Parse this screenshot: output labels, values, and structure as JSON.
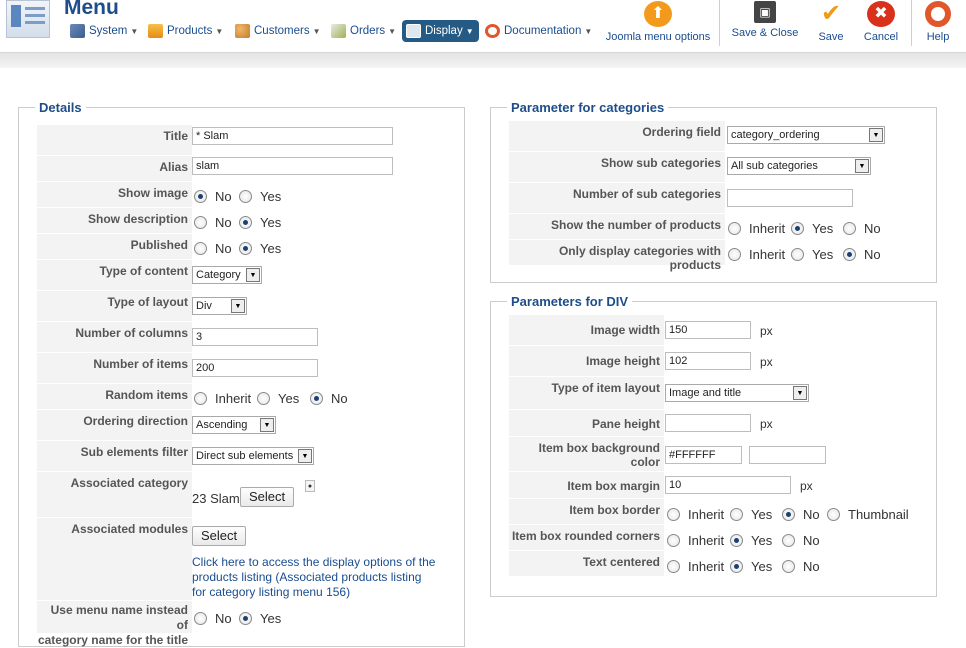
{
  "header": {
    "title": "Menu",
    "menus": [
      {
        "label": "System",
        "icon": "system-tools-icon",
        "active": false
      },
      {
        "label": "Products",
        "icon": "products-icon",
        "active": false
      },
      {
        "label": "Customers",
        "icon": "customers-icon",
        "active": false
      },
      {
        "label": "Orders",
        "icon": "orders-icon",
        "active": false
      },
      {
        "label": "Display",
        "icon": "display-icon",
        "active": true
      },
      {
        "label": "Documentation",
        "icon": "documentation-icon",
        "active": false
      }
    ],
    "toolbar": {
      "joomla_menu_options": "Joomla menu options",
      "save_close": "Save & Close",
      "save": "Save",
      "cancel": "Cancel",
      "help": "Help"
    },
    "colors": {
      "brand": "#1e4d8a",
      "active_menu": "#245a83",
      "orange": "#f39a1d",
      "cancel_red": "#d9311b"
    }
  },
  "details": {
    "legend": "Details",
    "title": {
      "label": "Title",
      "value": "* Slam"
    },
    "alias": {
      "label": "Alias",
      "value": "slam"
    },
    "show_image": {
      "label": "Show image",
      "options": [
        "No",
        "Yes"
      ],
      "selected": "No"
    },
    "show_description": {
      "label": "Show description",
      "options": [
        "No",
        "Yes"
      ],
      "selected": "Yes"
    },
    "published": {
      "label": "Published",
      "options": [
        "No",
        "Yes"
      ],
      "selected": "Yes"
    },
    "type_of_content": {
      "label": "Type of content",
      "value": "Category"
    },
    "type_of_layout": {
      "label": "Type of layout",
      "value": "Div"
    },
    "number_of_columns": {
      "label": "Number of columns",
      "value": "3"
    },
    "number_of_items": {
      "label": "Number of items",
      "value": "200"
    },
    "random_items": {
      "label": "Random items",
      "options": [
        "Inherit",
        "Yes",
        "No"
      ],
      "selected": "No"
    },
    "ordering_direction": {
      "label": "Ordering direction",
      "value": "Ascending"
    },
    "sub_elements_filter": {
      "label": "Sub elements filter",
      "value": "Direct sub elements"
    },
    "associated_category": {
      "label": "Associated category",
      "value": "23 Slam",
      "button": "Select"
    },
    "associated_modules": {
      "label": "Associated modules",
      "button": "Select",
      "link_lines": [
        "Click here to access the display options of the",
        "products listing (Associated products listing",
        "for category listing menu 156)"
      ]
    },
    "use_menu_name": {
      "label_lines": [
        "Use menu name instead of",
        "category name for the title"
      ],
      "options": [
        "No",
        "Yes"
      ],
      "selected": "Yes"
    }
  },
  "categories": {
    "legend": "Parameter for categories",
    "ordering_field": {
      "label": "Ordering field",
      "value": "category_ordering"
    },
    "show_sub_categories": {
      "label": "Show sub categories",
      "value": "All sub categories"
    },
    "number_sub_categories": {
      "label": "Number of sub categories",
      "value": ""
    },
    "show_number_products": {
      "label": "Show the number of products",
      "options": [
        "Inherit",
        "Yes",
        "No"
      ],
      "selected": "Yes"
    },
    "only_with_products": {
      "label": "Only display categories with products",
      "options": [
        "Inherit",
        "Yes",
        "No"
      ],
      "selected": "No"
    }
  },
  "div": {
    "legend": "Parameters for DIV",
    "image_width": {
      "label": "Image width",
      "value": "150",
      "unit": "px"
    },
    "image_height": {
      "label": "Image height",
      "value": "102",
      "unit": "px"
    },
    "type_item_layout": {
      "label": "Type of item layout",
      "value": "Image and title"
    },
    "pane_height": {
      "label": "Pane height",
      "value": "",
      "unit": "px"
    },
    "item_box_bg": {
      "label": "Item box background color",
      "value": "#FFFFFF",
      "value2": ""
    },
    "item_box_margin": {
      "label": "Item box margin",
      "value": "10",
      "unit": "px"
    },
    "item_box_border": {
      "label": "Item box border",
      "options": [
        "Inherit",
        "Yes",
        "No",
        "Thumbnail"
      ],
      "selected": "No"
    },
    "item_box_rounded": {
      "label": "Item box rounded corners",
      "options": [
        "Inherit",
        "Yes",
        "No"
      ],
      "selected": "Yes"
    },
    "text_centered": {
      "label": "Text centered",
      "options": [
        "Inherit",
        "Yes",
        "No"
      ],
      "selected": "Yes"
    }
  }
}
